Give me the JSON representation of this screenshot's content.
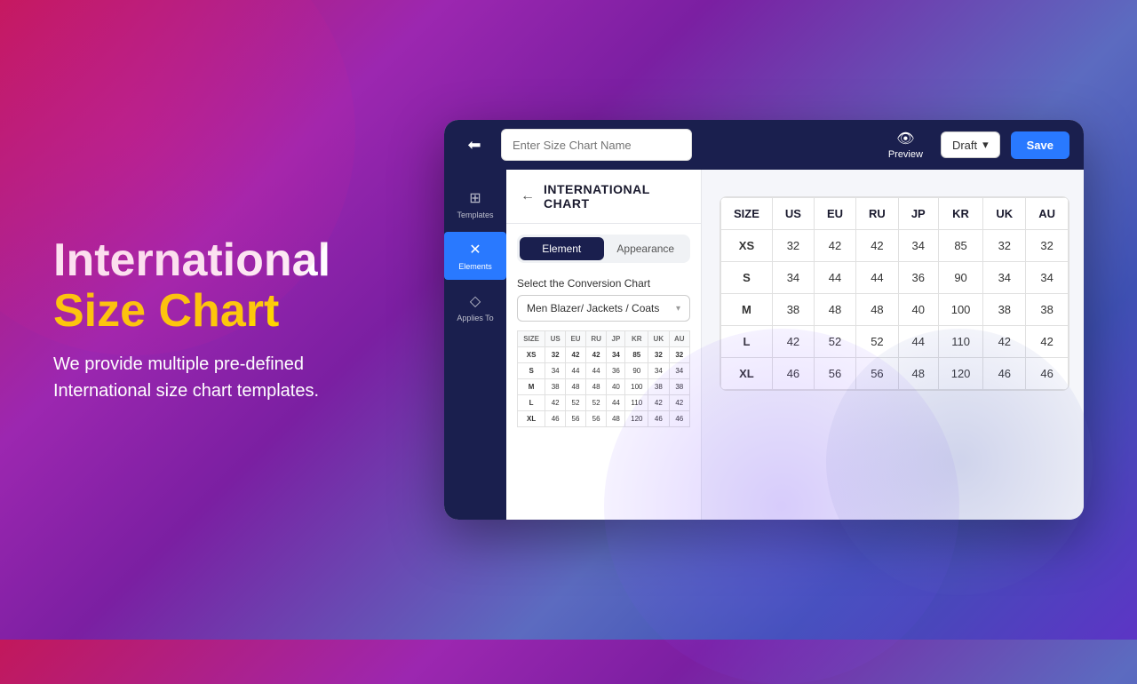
{
  "background": {
    "gradient": "purple-pink"
  },
  "left": {
    "title_line1": "International",
    "title_line2": "Size Chart",
    "description": "We provide multiple pre-defined International size chart templates."
  },
  "app": {
    "top_bar": {
      "back_icon": "⬅",
      "chart_name_placeholder": "Enter Size Chart Name",
      "preview_icon": "👁",
      "preview_label": "Preview",
      "draft_label": "Draft",
      "draft_arrow": "▾",
      "save_label": "Save"
    },
    "sidebar": {
      "items": [
        {
          "id": "templates",
          "icon": "⊞",
          "label": "Templates",
          "active": false
        },
        {
          "id": "elements",
          "icon": "✕",
          "label": "Elements",
          "active": true
        },
        {
          "id": "applies-to",
          "icon": "◇",
          "label": "Applies To",
          "active": false
        }
      ]
    },
    "panel": {
      "title": "INTERNATIONAL CHART",
      "tabs": [
        {
          "id": "element",
          "label": "Element",
          "active": true
        },
        {
          "id": "appearance",
          "label": "Appearance",
          "active": false
        }
      ],
      "conversion_label": "Select the Conversion Chart",
      "dropdown_value": "Men Blazer/ Jackets / Coats",
      "mini_table": {
        "headers": [
          "SIZE",
          "US",
          "EU",
          "RU",
          "JP",
          "KR",
          "UK",
          "AU"
        ],
        "rows": [
          [
            "XS",
            "32",
            "42",
            "42",
            "34",
            "85",
            "32",
            "32"
          ],
          [
            "S",
            "34",
            "44",
            "44",
            "36",
            "90",
            "34",
            "34"
          ],
          [
            "M",
            "38",
            "48",
            "48",
            "40",
            "100",
            "38",
            "38"
          ],
          [
            "L",
            "42",
            "52",
            "52",
            "44",
            "110",
            "42",
            "42"
          ],
          [
            "XL",
            "46",
            "56",
            "56",
            "48",
            "120",
            "46",
            "46"
          ]
        ]
      }
    },
    "preview_table": {
      "headers": [
        "SIZE",
        "US",
        "EU",
        "RU",
        "JP",
        "KR",
        "UK",
        "AU"
      ],
      "rows": [
        [
          "XS",
          "32",
          "42",
          "42",
          "34",
          "85",
          "32",
          "32"
        ],
        [
          "S",
          "34",
          "44",
          "44",
          "36",
          "90",
          "34",
          "34"
        ],
        [
          "M",
          "38",
          "48",
          "48",
          "40",
          "100",
          "38",
          "38"
        ],
        [
          "L",
          "42",
          "52",
          "52",
          "44",
          "110",
          "42",
          "42"
        ],
        [
          "XL",
          "46",
          "56",
          "56",
          "48",
          "120",
          "46",
          "46"
        ]
      ]
    }
  }
}
